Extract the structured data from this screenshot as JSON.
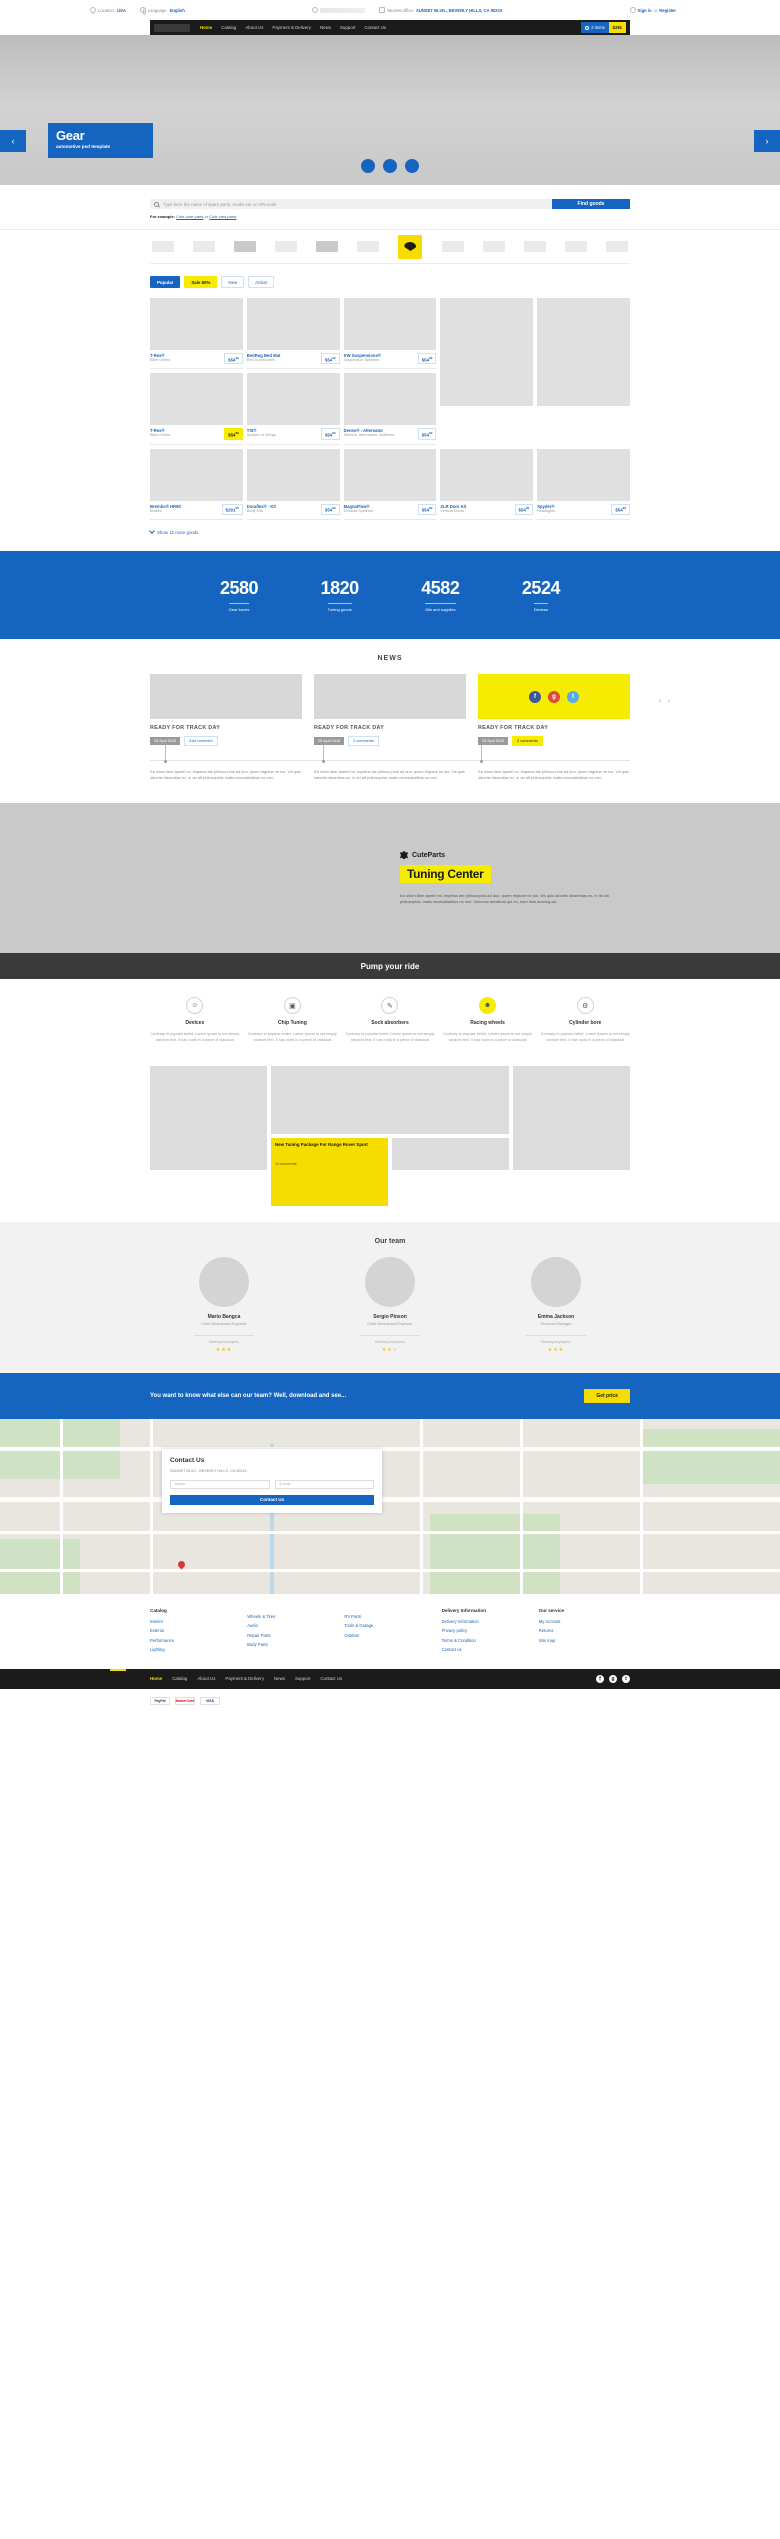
{
  "topbar": {
    "location_label": "Location:",
    "location_value": "USA",
    "language_label": "Language:",
    "language_value": "English",
    "office_label": "Nearest office:",
    "office_value": "SUNSET BLVD., BEVERLY HILLS, CA 90210",
    "signin": "Sign in",
    "or": "or",
    "register": "Register"
  },
  "nav": {
    "items": [
      "Home",
      "Catalog",
      "About Us",
      "Payment & Delivery",
      "News",
      "Support",
      "Contact Us"
    ],
    "cart_items": "2 items",
    "cart_total": "$281"
  },
  "hero": {
    "title": "Gear",
    "subtitle": "automotive psd template",
    "prev": "‹",
    "next": "›"
  },
  "search": {
    "placeholder": "Type here the name of spare parts, model car or VIN-code",
    "button": "Find goods",
    "example_label": "For example:",
    "example_1": "Cute-cute parts",
    "example_or": "or",
    "example_2": "Cute cars parts"
  },
  "products": {
    "tabs": [
      "Popular",
      "Sale 50%",
      "New",
      "Action"
    ],
    "items": [
      {
        "name": "T-Rex®",
        "cat": "Billet Grilles",
        "price": "$54",
        "cents": "99",
        "highlight": false
      },
      {
        "name": "BedRug Bed Mat",
        "cat": "Bed Accessories",
        "price": "$54",
        "cents": "99",
        "highlight": false
      },
      {
        "name": "KW Suspensions®",
        "cat": "Suspension Systems",
        "price": "$54",
        "cents": "99",
        "highlight": false
      },
      {
        "name": "T-Rex®",
        "cat": "Billet Grilles",
        "price": "$54",
        "cents": "99",
        "highlight": true
      },
      {
        "name": "TSI®",
        "cat": "Spoilers & Wings",
        "price": "$54",
        "cents": "99",
        "highlight": false
      },
      {
        "name": "Denso® - Alternator",
        "cat": "Starters, Alternators, Batteries",
        "price": "$54",
        "cents": "99",
        "highlight": false
      },
      {
        "name": "Brembo® HR80",
        "cat": "Brakes",
        "price": "$291",
        "cents": "95",
        "highlight": false
      },
      {
        "name": "Duraflex® - Kit",
        "cat": "Body Kits",
        "price": "$54",
        "cents": "99",
        "highlight": false
      },
      {
        "name": "MagnaFlow®",
        "cat": "Exhaust Systems",
        "price": "$54",
        "cents": "99",
        "highlight": false
      },
      {
        "name": "ZLR Door Kit",
        "cat": "Vertical Doors",
        "price": "$54",
        "cents": "99",
        "highlight": false
      },
      {
        "name": "Spyder®",
        "cat": "Headlights",
        "price": "$54",
        "cents": "99",
        "highlight": false
      }
    ],
    "show_more": "Show 12 more goods"
  },
  "stats": [
    {
      "number": "2580",
      "label": "Gear boxes"
    },
    {
      "number": "1820",
      "label": "Tuning goods"
    },
    {
      "number": "4582",
      "label": "Oils and supplies"
    },
    {
      "number": "2524",
      "label": "Devices"
    }
  ],
  "news": {
    "heading": "NEWS",
    "prev": "‹",
    "next": "›",
    "items": [
      {
        "title": "READY FOR TRACK DAY",
        "date": "25 April 2015",
        "comments": "Add comment",
        "highlight": false,
        "excerpt": "Ea ullum liber aperiri mi, impetus ate philoso phia ad duo, quem regione ne ius. Vis quis lobortis dissentias ex, in du aft philosophia, malis necessitatibus no mei."
      },
      {
        "title": "READY FOR TRACK DAY",
        "date": "25 April 2015",
        "comments": "2 comments",
        "highlight": false,
        "excerpt": "Ea ullum liber aperiri mi, impetus ate philoso phia ad duo, quem regione ne ius. Vis quis lobortis dissentias ex, in du aft philosophia, malis necessitatibus no mei."
      },
      {
        "title": "READY FOR TRACK DAY",
        "date": "25 April 2015",
        "comments": "2 comments",
        "highlight": true,
        "excerpt": "Ea ullum liber aperiri mi, impetus ate philoso phia ad duo, quem regione ne ius. Vis quis lobortis dissentias ex, in du aft philosophia, malis necessitatibus no mei."
      }
    ],
    "social": [
      "f",
      "g",
      "t"
    ]
  },
  "tuning": {
    "brand": "CuteParts",
    "title": "Tuning Center",
    "text": "Ea ullum liber aperiri mi, impetus ate philosophia ad duo, quem regione ne ius. Vis quis lobortis dissentias ex, in du aft philosophia, malis necessitatibus no mei. Volumus sensibus qui ex, eum duis doming ad."
  },
  "pump": {
    "title": "Pump your ride"
  },
  "features": [
    {
      "icon": "smile-icon",
      "glyph": "☺",
      "name": "Devices",
      "desc": "Contrary to popular belief, Lorem Ipsum is not simply random text. It has roots in a piece of classical"
    },
    {
      "icon": "chip-icon",
      "glyph": "▣",
      "name": "Chip Tuning",
      "desc": "Contrary to popular belief, Lorem Ipsum is not simply random text. It has roots in a piece of classical"
    },
    {
      "icon": "shock-icon",
      "glyph": "✎",
      "name": "Sock absorbers",
      "desc": "Contrary to popular belief, Lorem Ipsum is not simply random text. It has roots in a piece of classical"
    },
    {
      "icon": "wheel-icon",
      "glyph": "☻",
      "name": "Racing wheels",
      "desc": "Contrary to popular belief, Lorem Ipsum is not simply random text. It has roots in a piece of classical"
    },
    {
      "icon": "cylinder-icon",
      "glyph": "⚙",
      "name": "Cylinder bore",
      "desc": "Contrary to popular belief, Lorem Ipsum is not simply random text. It has roots in a piece of classical"
    }
  ],
  "gallery": {
    "promo_title": "New Tuning Package For Range Rover Sport",
    "promo_comments": "14 comments"
  },
  "team": {
    "heading": "Our team",
    "members": [
      {
        "name": "Mario Bangca",
        "role": "Chief Mechanical Engineer",
        "rank_label": "Ranking employees",
        "stars": 3
      },
      {
        "name": "Sergio Pinson",
        "role": "Chief Mechanical Engineer",
        "rank_label": "Ranking employees",
        "stars": 2
      },
      {
        "name": "Emma Jackson",
        "role": "Personal Manager",
        "rank_label": "Ranking employees",
        "stars": 3
      }
    ]
  },
  "cta": {
    "text": "You want to know what else can our team? Well, download and see...",
    "button": "Get price"
  },
  "contact": {
    "heading": "Contact Us",
    "address": "SUNSET BLVD., BEVERLY HILLS, CA 90210",
    "name_placeholder": "Name",
    "email_placeholder": "E-mail",
    "button": "Contact Us"
  },
  "footer": {
    "columns": [
      {
        "heading": "Catalog",
        "links": [
          "Interior",
          "Exterior",
          "Performance",
          "Lighting"
        ]
      },
      {
        "heading": "",
        "links": [
          "Wheels & Tires",
          "Audio",
          "Repair Parts",
          "Body Parts"
        ]
      },
      {
        "heading": "",
        "links": [
          "RV Parts",
          "Tools & Garage",
          "Outdoor"
        ]
      },
      {
        "heading": "Delivery Information",
        "links": [
          "Delivery Information",
          "Privacy policy",
          "Terms & Condition",
          "Contact us"
        ]
      },
      {
        "heading": "Our service",
        "links": [
          "My Account",
          "Returns",
          "Site map"
        ]
      }
    ],
    "nav": [
      "Home",
      "Catalog",
      "About Us",
      "Payment & Delivery",
      "News",
      "Support",
      "Contact Us"
    ],
    "social": [
      "f",
      "g",
      "t"
    ],
    "payments": [
      "PayPal",
      "MasterCard",
      "VISA"
    ]
  },
  "colors": {
    "brand_blue": "#1565c0",
    "accent_yellow": "#f5dd00",
    "dark": "#1b1b1b"
  }
}
